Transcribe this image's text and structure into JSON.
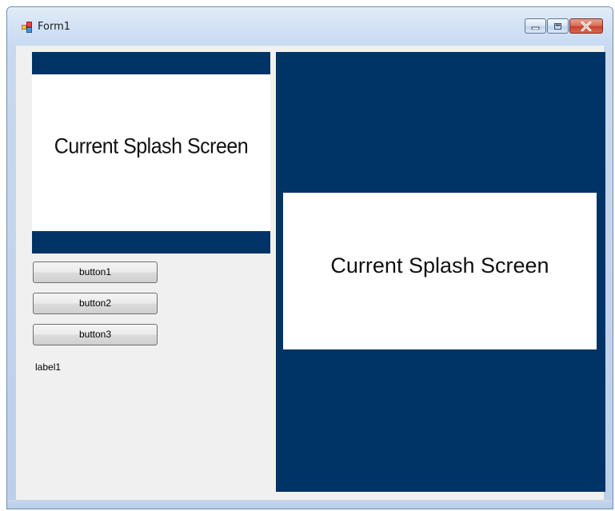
{
  "window": {
    "title": "Form1",
    "icon": "winforms-app-icon",
    "caption_buttons": [
      "minimize",
      "maximize",
      "close"
    ]
  },
  "preview_small": {
    "text": "Current Splash Screen"
  },
  "preview_large": {
    "text": "Current Splash Screen"
  },
  "buttons": {
    "button1": "button1",
    "button2": "button2",
    "button3": "button3"
  },
  "label1": "label1",
  "colors": {
    "splash_band": "#003366",
    "client_bg": "#f0f0f0",
    "close_button": "#c7442b"
  }
}
